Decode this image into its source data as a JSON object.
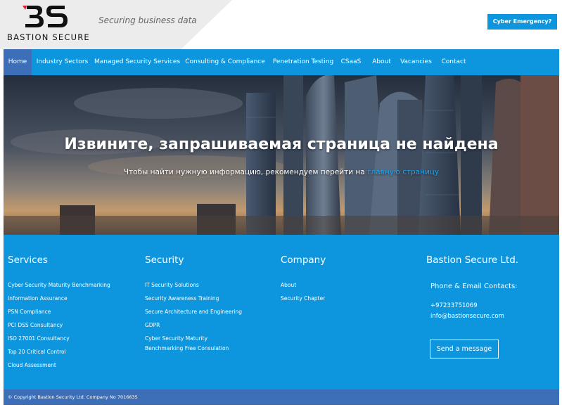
{
  "header": {
    "logo_text": "BASTION SECURE",
    "tagline": "Securing business data",
    "cyber_button": "Cyber Emergency?"
  },
  "nav": {
    "items": [
      {
        "label": "Home",
        "active": true
      },
      {
        "label": "Industry Sectors"
      },
      {
        "label": "Managed Security Services"
      },
      {
        "label": "Consulting & Compliance"
      },
      {
        "label": "Penetration Testing"
      },
      {
        "label": "CSaaS"
      },
      {
        "label": "About"
      },
      {
        "label": "Vacancies"
      },
      {
        "label": "Contact"
      }
    ]
  },
  "hero": {
    "title": "Извините, запрашиваемая страница не найдена",
    "subtitle_prefix": "Чтобы найти нужную информацию, рекомендуем перейти на ",
    "subtitle_link": "главную страницу"
  },
  "footer": {
    "services": {
      "title": "Services",
      "links": [
        "Cyber Security Maturity Benchmarking",
        "Information Assurance",
        "PSN Compliance",
        "PCI DSS Consultancy",
        "ISO 27001 Consultancy",
        "Top 20 Critical Control",
        "Cloud Assessment"
      ]
    },
    "security": {
      "title": "Security",
      "links": [
        "IT Security Solutions",
        "Security Awareness Training",
        "Secure Architecture and Engineering",
        "GDPR",
        "Cyber Security Maturity",
        "Benchmarking Free Consulation"
      ]
    },
    "company": {
      "title": "Company",
      "links": [
        "About",
        "Security Chapter"
      ]
    },
    "contact": {
      "title": "Bastion Secure Ltd.",
      "heading": "Phone & Email Contacts:",
      "phone": "+97233751069",
      "email": "info@bastionsecure.com",
      "button": "Send a message"
    },
    "copyright": "© Copyright Bastion Security Ltd.     Company No 7016635"
  },
  "colors": {
    "accent": "#0d96dd",
    "nav_active": "#3d6fb8",
    "link": "#1fa7ee",
    "logo_red": "#d9232e"
  }
}
